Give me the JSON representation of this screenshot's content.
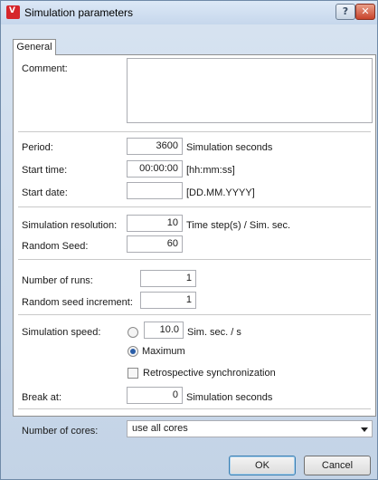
{
  "window": {
    "title": "Simulation parameters",
    "help_label": "?",
    "close_label": "✕",
    "app_icon_text": "V"
  },
  "tabs": [
    {
      "label": "General"
    }
  ],
  "comment": {
    "label": "Comment:",
    "value": ""
  },
  "period": {
    "label": "Period:",
    "value": "3600",
    "unit": "Simulation seconds"
  },
  "start_time": {
    "label": "Start time:",
    "value": "00:00:00",
    "unit": "[hh:mm:ss]"
  },
  "start_date": {
    "label": "Start date:",
    "value": "",
    "unit": "[DD.MM.YYYY]"
  },
  "sim_resolution": {
    "label": "Simulation resolution:",
    "value": "10",
    "unit": "Time step(s) / Sim. sec."
  },
  "random_seed": {
    "label": "Random Seed:",
    "value": "60"
  },
  "num_runs": {
    "label": "Number of runs:",
    "value": "1"
  },
  "seed_increment": {
    "label": "Random seed increment:",
    "value": "1"
  },
  "sim_speed": {
    "label": "Simulation speed:",
    "value": "10.0",
    "unit": "Sim. sec. / s",
    "maximum_label": "Maximum",
    "selected": "maximum"
  },
  "retrospective": {
    "label": "Retrospective synchronization",
    "checked": false
  },
  "break_at": {
    "label": "Break at:",
    "value": "0",
    "unit": "Simulation seconds"
  },
  "cores": {
    "label": "Number of cores:",
    "value": "use all cores"
  },
  "buttons": {
    "ok": "OK",
    "cancel": "Cancel"
  }
}
